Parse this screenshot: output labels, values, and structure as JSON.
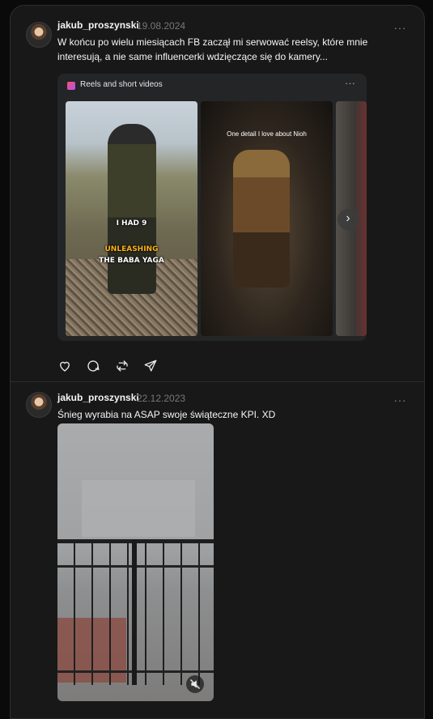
{
  "posts": [
    {
      "username": "jakub_proszynski",
      "date": "19.08.2024",
      "more_label": "···",
      "text": "W końcu po wielu miesiącach FB zaczął mi serwować reelsy, które mnie interesują, a nie same influencerki wdzięczące się do kamery...",
      "embed": {
        "title": "Reels and short videos",
        "more_label": "···",
        "reels": [
          {
            "caption_lines": [
              "I HAD 9",
              "UNLEASHING",
              "THE BABA YAGA"
            ]
          },
          {
            "caption_lines": [
              "One detail I love about Nioh"
            ]
          },
          {
            "caption_lines": []
          }
        ],
        "next_label": "›"
      },
      "actions": [
        "heart-icon",
        "comment-icon",
        "repost-icon",
        "share-icon"
      ]
    },
    {
      "username": "jakub_proszynski",
      "date": "22.12.2023",
      "more_label": "···",
      "text": "Śnieg wyrabia na ASAP swoje świąteczne KPI. XD",
      "media": {
        "type": "video",
        "mute_icon": "muted-speaker-icon"
      }
    }
  ],
  "colors": {
    "background": "#0a0a0a",
    "card": "#181818",
    "divider": "#2d2d2d",
    "muted_text": "#777777",
    "accent_orange": "#ffb21a"
  }
}
